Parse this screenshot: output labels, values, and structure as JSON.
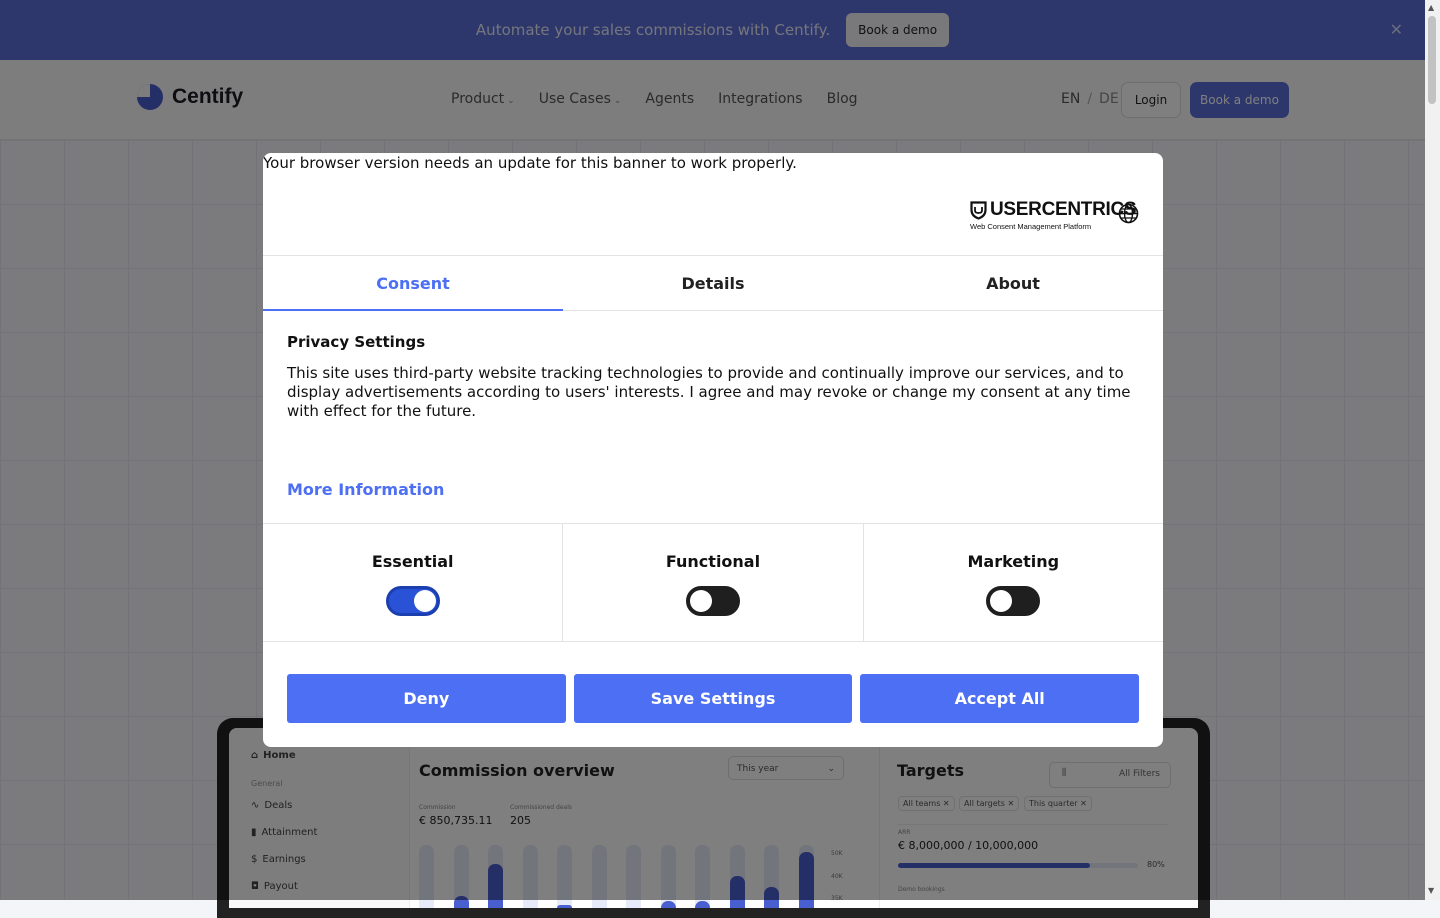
{
  "announcement": {
    "text": "Automate your sales commissions with Centify.",
    "cta_label": "Book a demo",
    "close_icon": "close-icon"
  },
  "nav": {
    "brand": "Centify",
    "links": [
      {
        "label": "Product",
        "has_dropdown": true
      },
      {
        "label": "Use Cases",
        "has_dropdown": true
      },
      {
        "label": "Agents",
        "has_dropdown": false
      },
      {
        "label": "Integrations",
        "has_dropdown": false
      },
      {
        "label": "Blog",
        "has_dropdown": false
      }
    ],
    "lang_en": "EN",
    "lang_sep": "/",
    "lang_de": "DE",
    "login_label": "Login",
    "demo_label": "Book a demo"
  },
  "app_preview": {
    "sidebar": {
      "home": "Home",
      "section": "General",
      "items": [
        "Deals",
        "Attainment",
        "Earnings",
        "Payout"
      ]
    },
    "commission_overview": {
      "title": "Commission overview",
      "period": "This year",
      "kpis": [
        {
          "label": "Commission",
          "value": "€ 850,735.11"
        },
        {
          "label": "Commissioned deals",
          "value": "205"
        }
      ],
      "y_ticks": [
        "50K",
        "40K",
        "35K"
      ]
    },
    "targets": {
      "title": "Targets",
      "filters_label": "All Filters",
      "chips": [
        "All teams ✕",
        "All targets ✕",
        "This quarter ✕"
      ],
      "arr_label": "ARR",
      "arr_value": "€ 8,000,000 / 10,000,000",
      "arr_progress": 0.8,
      "arr_percent": "80%",
      "demo_label": "Demo bookings"
    }
  },
  "consent": {
    "warning": "Your browser version needs an update for this banner to work properly.",
    "brand": "USERCENTRICS",
    "brand_sub": "Web Consent Management Platform",
    "tabs": [
      "Consent",
      "Details",
      "About"
    ],
    "active_tab": "Consent",
    "title": "Privacy Settings",
    "body": "This site uses third-party website tracking technologies to provide and continually improve our services, and to display advertisements according to users' interests. I agree and may revoke or change my consent at any time with effect for the future.",
    "more_info": "More Information",
    "categories": [
      {
        "label": "Essential",
        "enabled": true
      },
      {
        "label": "Functional",
        "enabled": false
      },
      {
        "label": "Marketing",
        "enabled": false
      }
    ],
    "buttons": {
      "deny": "Deny",
      "save": "Save Settings",
      "accept": "Accept All"
    },
    "accent_color": "#4c6ff3"
  }
}
